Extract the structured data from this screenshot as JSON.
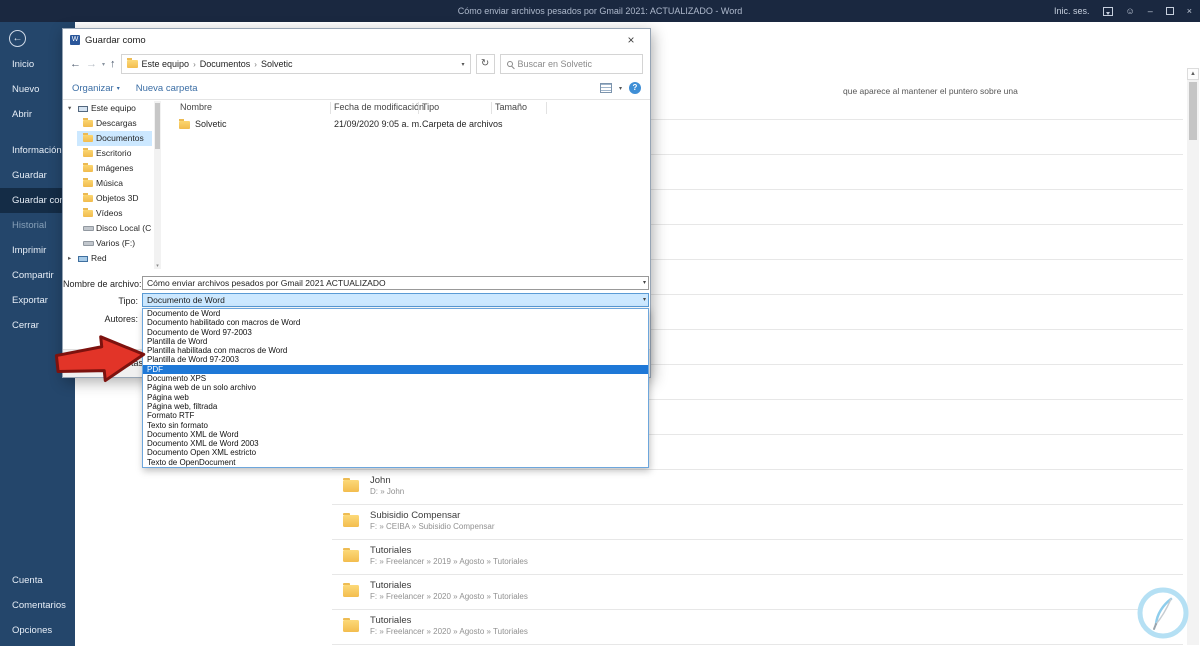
{
  "titlebar": {
    "title": "Cómo enviar archivos pesados por Gmail 2021: ACTUALIZADO  -  Word",
    "signin": "Inic. ses."
  },
  "backstage": {
    "nav_top": [
      {
        "label": "Inicio"
      },
      {
        "label": "Nuevo"
      },
      {
        "label": "Abrir"
      }
    ],
    "nav_mid": [
      {
        "label": "Información"
      },
      {
        "label": "Guardar"
      },
      {
        "label": "Guardar como",
        "selected": true
      },
      {
        "label": "Historial",
        "disabled": true
      },
      {
        "label": "Imprimir"
      },
      {
        "label": "Compartir"
      },
      {
        "label": "Exportar"
      },
      {
        "label": "Cerrar"
      }
    ],
    "nav_bottom": [
      {
        "label": "Cuenta"
      },
      {
        "label": "Comentarios"
      },
      {
        "label": "Opciones"
      }
    ],
    "fragment_text": "que aparece al mantener el puntero sobre una",
    "recent_folders": [
      {
        "name": "John",
        "path": "D: » John"
      },
      {
        "name": "Subisidio Compensar",
        "path": "F: » CEIBA » Subisidio Compensar"
      },
      {
        "name": "Tutoriales",
        "path": "F: » Freelancer » 2019 » Agosto » Tutoriales"
      },
      {
        "name": "Tutoriales",
        "path": "F: » Freelancer » 2020 » Agosto » Tutoriales"
      },
      {
        "name": "Tutoriales",
        "path": "F: » Freelancer » 2020 » Agosto » Tutoriales"
      }
    ]
  },
  "dialog": {
    "title": "Guardar como",
    "breadcrumb": [
      "Este equipo",
      "Documentos",
      "Solvetic"
    ],
    "search_placeholder": "Buscar en Solvetic",
    "toolbar": {
      "organize": "Organizar",
      "new_folder": "Nueva carpeta"
    },
    "tree": [
      {
        "label": "Este equipo",
        "icon": "pc",
        "level": 0,
        "expander": "open"
      },
      {
        "label": "Descargas",
        "icon": "folder",
        "level": 1
      },
      {
        "label": "Documentos",
        "icon": "folder",
        "level": 1,
        "selected": true
      },
      {
        "label": "Escritorio",
        "icon": "folder",
        "level": 1
      },
      {
        "label": "Imágenes",
        "icon": "folder",
        "level": 1
      },
      {
        "label": "Música",
        "icon": "folder",
        "level": 1
      },
      {
        "label": "Objetos 3D",
        "icon": "folder",
        "level": 1
      },
      {
        "label": "Vídeos",
        "icon": "folder",
        "level": 1
      },
      {
        "label": "Disco Local (C:)",
        "icon": "drive",
        "level": 1
      },
      {
        "label": "Varios (F:)",
        "icon": "drive",
        "level": 1
      },
      {
        "label": "Red",
        "icon": "network",
        "level": 0,
        "expander": "closed"
      }
    ],
    "columns": [
      "Nombre",
      "Fecha de modificación",
      "Tipo",
      "Tamaño"
    ],
    "files": [
      {
        "name": "Solvetic",
        "modified": "21/09/2020 9:05 a. m.",
        "type": "Carpeta de archivos",
        "size": ""
      }
    ],
    "filename_label": "Nombre de archivo:",
    "filename_value": "Cómo enviar archivos pesados por Gmail 2021  ACTUALIZADO",
    "type_label": "Tipo:",
    "type_value": "Documento de Word",
    "authors_label": "Autores:",
    "type_options": [
      "Documento de Word",
      "Documento habilitado con macros de Word",
      "Documento de Word 97-2003",
      "Plantilla de Word",
      "Plantilla habilitada con macros de Word",
      "Plantilla de Word 97-2003",
      "PDF",
      "Documento XPS",
      "Página web de un solo archivo",
      "Página web",
      "Página web, filtrada",
      "Formato RTF",
      "Texto sin formato",
      "Documento XML de Word",
      "Documento XML de Word 2003",
      "Documento Open XML estricto",
      "Texto de OpenDocument"
    ],
    "selected_option": "PDF",
    "hide_folders_label": "Ocultar carpetas"
  },
  "icons": {
    "back": "←",
    "forward": "→",
    "up": "↑",
    "refresh": "↻",
    "chevron": "▾",
    "crumb_sep": "›",
    "expand_open": "▾",
    "expand_closed": "▸",
    "scroll_up": "▲",
    "smiley": "☺",
    "minimize": "–",
    "close": "×",
    "help": "?"
  },
  "colors": {
    "titlebar": "#1a2840",
    "sidebar": "#24466b",
    "selection": "#cce8ff",
    "option_highlight": "#1e78d7",
    "annotation_red": "#e23428"
  }
}
